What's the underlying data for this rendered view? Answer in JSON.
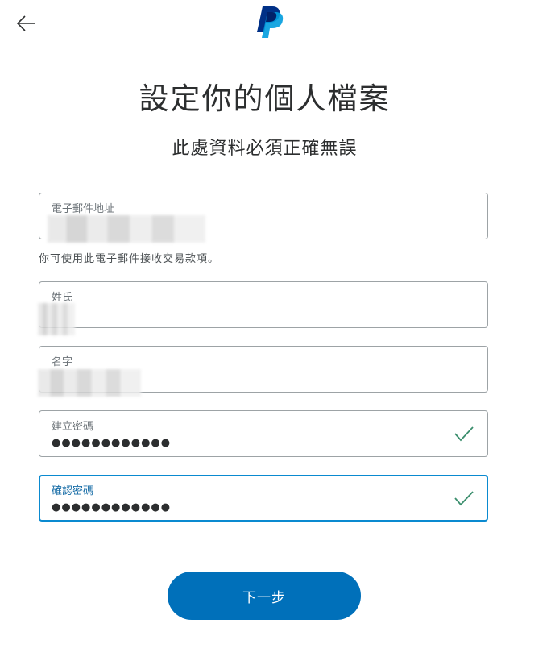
{
  "header": {
    "back_icon": "arrow-left-icon",
    "logo_icon": "paypal-logo-icon",
    "brand_colors": {
      "dark": "#003087",
      "light": "#009cde"
    }
  },
  "page": {
    "title": "設定你的個人檔案",
    "subtitle": "此處資料必須正確無誤"
  },
  "form": {
    "email": {
      "label": "電子郵件地址",
      "value": ""
    },
    "email_helper": "你可使用此電子郵件接收交易款項。",
    "last_name": {
      "label": "姓氏",
      "value": ""
    },
    "first_name": {
      "label": "名字",
      "value": ""
    },
    "password": {
      "label": "建立密碼",
      "value": "●●●●●●●●●●●●",
      "valid_icon": "checkmark-icon"
    },
    "confirm_password": {
      "label": "確認密碼",
      "value": "●●●●●●●●●●●●",
      "valid_icon": "checkmark-icon"
    }
  },
  "actions": {
    "next_label": "下一步"
  },
  "colors": {
    "primary": "#0070ba",
    "focus_border": "#0a8ad0",
    "valid_check": "#3c8f6e",
    "border": "#9da3a6"
  }
}
